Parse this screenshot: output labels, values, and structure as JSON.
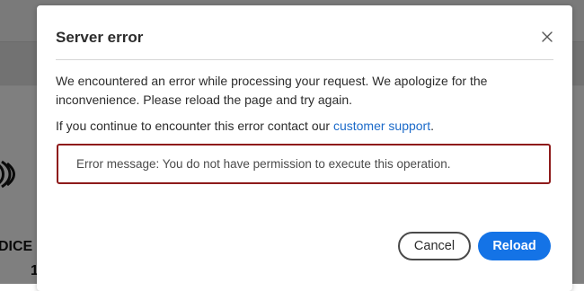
{
  "background": {
    "partial_text_1": "DICE",
    "partial_text_2": "1"
  },
  "dialog": {
    "title": "Server error",
    "close_icon": "close-icon",
    "message_line_1": "We encountered an error while processing your request. We apologize for the inconvenience. Please reload the page and try again.",
    "message_line_2_prefix": "If you continue to encounter this error contact our ",
    "support_link": "customer support",
    "message_line_2_suffix": ".",
    "error_message": "Error message: You do not have permission to execute this operation.",
    "cancel_label": "Cancel",
    "reload_label": "Reload"
  },
  "colors": {
    "accent": "#1473e6",
    "link": "#1b6ac9",
    "error_border": "#8e1b1b",
    "overlay": "#7b7b7b"
  }
}
